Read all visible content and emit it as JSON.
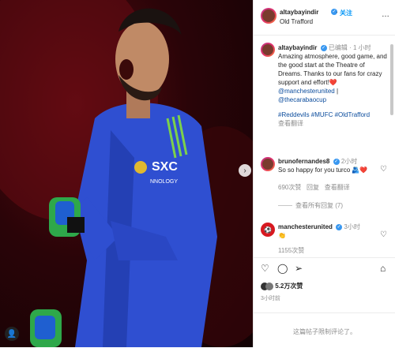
{
  "header": {
    "username": "altaybayindir",
    "follow_label": "关注",
    "location": "Old Trafford"
  },
  "post": {
    "author": "altaybayindir",
    "edited": "已编辑",
    "time": "1 小时",
    "caption_text": "Amazing atmosphere, good game, and the good start at the Theatre of Dreams. Thanks to our fans for crazy support and effort!",
    "caption_heart": "❤️",
    "mention1": "@manchesterunited",
    "separator": "|",
    "mention2": "@thecarabaocup",
    "hashtags": "#Reddevils #MUFC #OldTrafford",
    "translate": "查看翻译"
  },
  "comments": [
    {
      "user": "brunofernandes8",
      "time": "2小时",
      "text": "So so happy for you turco 🫂❤️",
      "likes": "690次赞",
      "reply": "回复",
      "translate": "查看翻译",
      "view_replies": "查看所有回复 (7)"
    },
    {
      "user": "manchesterunited",
      "time": "3小时",
      "text": "👏",
      "likes": "1155次赞"
    }
  ],
  "engagement": {
    "likes": "5.2万次赞",
    "time": "3小时前"
  },
  "comment_box": {
    "placeholder": "这篇帖子限制评论了。"
  },
  "icons": {
    "heart": "heart-icon",
    "comment": "comment-icon",
    "share": "share-icon",
    "bookmark": "bookmark-icon",
    "more": "more-icon",
    "next": "chevron-right-icon",
    "verified": "verified-badge-icon"
  },
  "colors": {
    "jersey": "#2f4fd1",
    "background": "#3a0509",
    "link": "#0a4b9c",
    "verified": "#3897f0"
  }
}
